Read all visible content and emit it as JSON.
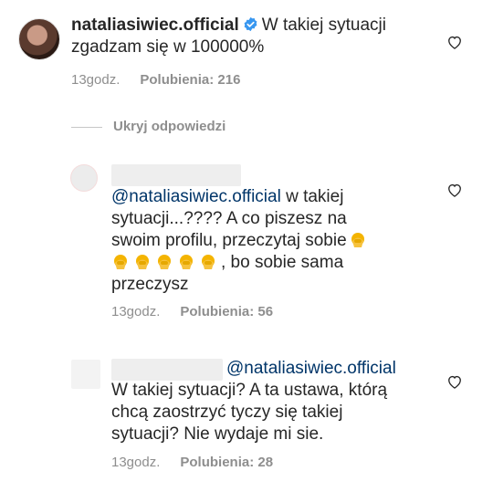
{
  "comment_main": {
    "username": "nataliasiwiec.official",
    "text_line1": "W takiej sytuacji",
    "text_line2": "zgadzam się w 100000%",
    "time": "13godz.",
    "likes": "Polubienia: 216"
  },
  "replies_toggle": {
    "label": "Ukryj odpowiedzi"
  },
  "reply_1": {
    "mention": "@nataliasiwiec.official",
    "line1_rest": " w takiej",
    "line2": "sytuacji...???? A co piszesz na",
    "line3": "swoim profilu, przeczytaj sobie",
    "line4_rest": ", bo sobie sama",
    "line5": "przeczysz",
    "time": "13godz.",
    "likes": "Polubienia: 56"
  },
  "reply_2": {
    "mention": "@nataliasiwiec.official",
    "line1": "W takiej sytuacji? A ta ustawa, którą",
    "line2": "chcą zaostrzyć tyczy się takiej",
    "line3": "sytuacji? Nie wydaje mi sie.",
    "time": "13godz.",
    "likes": "Polubienia: 28"
  },
  "colors": {
    "text": "#262626",
    "meta": "#8e8e8e",
    "mention": "#003569",
    "verified": "#3897f0"
  },
  "icons": [
    "verified-badge-icon",
    "heart-outline-icon",
    "facepalm-emoji-icon"
  ]
}
